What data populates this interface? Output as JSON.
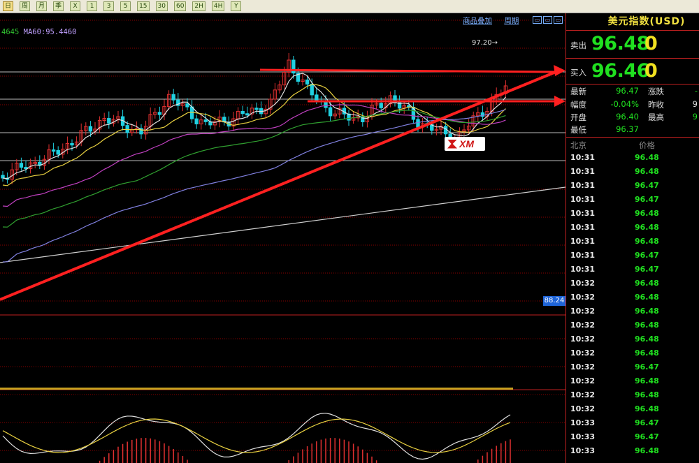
{
  "toolbar": {
    "buttons": [
      "日",
      "周",
      "月",
      "季",
      "X",
      "1",
      "3",
      "5",
      "15",
      "30",
      "60",
      "2H",
      "4H",
      "Y"
    ]
  },
  "chart": {
    "ma_legend_a": "4645",
    "ma_legend_b": "MA60:95.4460",
    "links": [
      "商品叠加",
      "周期"
    ],
    "high_label": "97.20→",
    "price_tag": "88.24",
    "logo": "XM",
    "colors": {
      "up": "#e03030",
      "down": "#20d0e0",
      "annotation": "#ff2020",
      "grid": "#8a0000"
    }
  },
  "panel": {
    "title": "美元指数(USD)",
    "sell_label": "卖出",
    "sell_value": "96.48",
    "sell_volume": "0",
    "buy_label": "买入",
    "buy_value": "96.46",
    "buy_volume": "0",
    "stats": {
      "latest_label": "最新",
      "latest_value": "96.47",
      "change_label": "涨跌",
      "change_value": "-",
      "amplitude_label": "幅度",
      "amplitude_value": "-0.04%",
      "prev_close_label": "昨收",
      "prev_close_value": "9",
      "open_label": "开盘",
      "open_value": "96.40",
      "high_label": "最高",
      "high_value": "9",
      "low_label": "最低",
      "low_value": "96.37"
    },
    "ticks_head": {
      "time": "北京",
      "price": "价格"
    },
    "ticks": [
      {
        "time": "10:31",
        "price": "96.48"
      },
      {
        "time": "10:31",
        "price": "96.48"
      },
      {
        "time": "10:31",
        "price": "96.47"
      },
      {
        "time": "10:31",
        "price": "96.47"
      },
      {
        "time": "10:31",
        "price": "96.48"
      },
      {
        "time": "10:31",
        "price": "96.48"
      },
      {
        "time": "10:31",
        "price": "96.48"
      },
      {
        "time": "10:31",
        "price": "96.47"
      },
      {
        "time": "10:31",
        "price": "96.47"
      },
      {
        "time": "10:32",
        "price": "96.48"
      },
      {
        "time": "10:32",
        "price": "96.48"
      },
      {
        "time": "10:32",
        "price": "96.48"
      },
      {
        "time": "10:32",
        "price": "96.48"
      },
      {
        "time": "10:32",
        "price": "96.48"
      },
      {
        "time": "10:32",
        "price": "96.48"
      },
      {
        "time": "10:32",
        "price": "96.47"
      },
      {
        "time": "10:32",
        "price": "96.48"
      },
      {
        "time": "10:32",
        "price": "96.48"
      },
      {
        "time": "10:32",
        "price": "96.48"
      },
      {
        "time": "10:33",
        "price": "96.47"
      },
      {
        "time": "10:33",
        "price": "96.47"
      },
      {
        "time": "10:33",
        "price": "96.48"
      }
    ]
  }
}
